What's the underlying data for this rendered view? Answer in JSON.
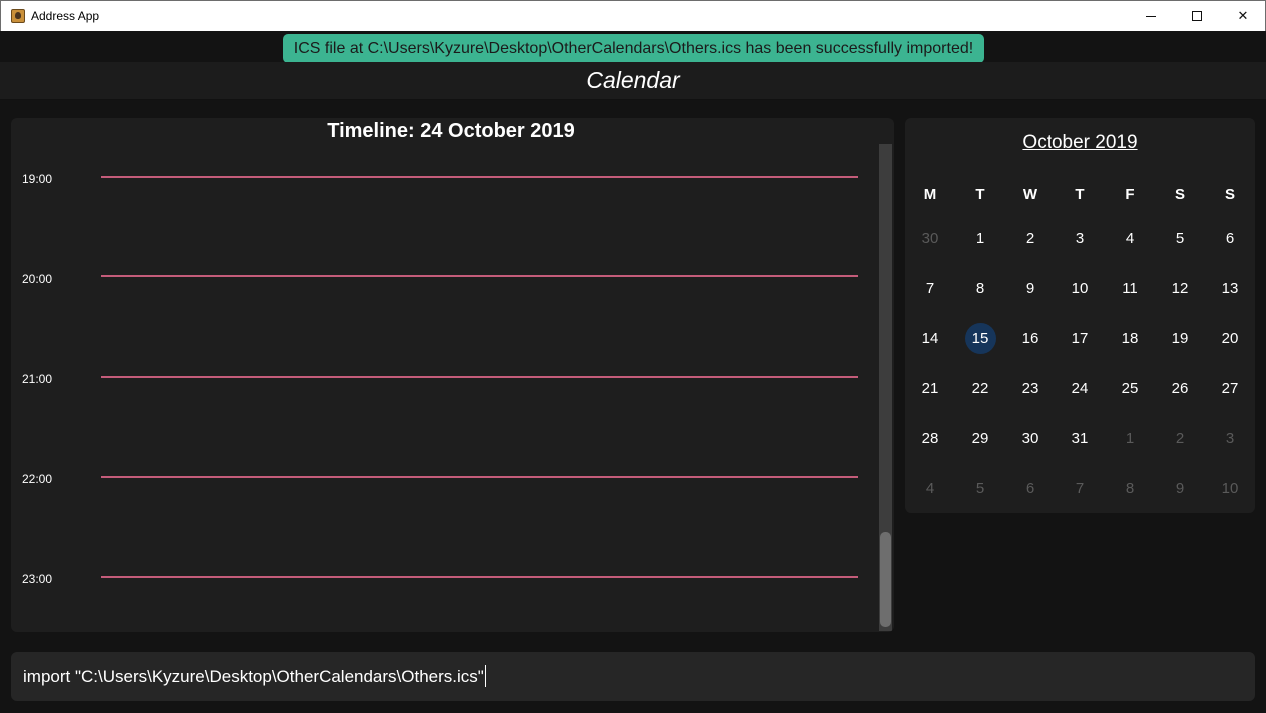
{
  "window": {
    "title": "Address App",
    "min_glyph": "—",
    "close_glyph": "✕"
  },
  "toast": {
    "message": "ICS file at C:\\Users\\Kyzure\\Desktop\\OtherCalendars\\Others.ics has been successfully imported!",
    "color": "#3cb491"
  },
  "header": {
    "title": "Calendar"
  },
  "timeline": {
    "title": "Timeline: 24 October 2019",
    "hours": [
      "19:00",
      "20:00",
      "21:00",
      "22:00",
      "23:00"
    ],
    "line_color": "#c45c7a"
  },
  "calendar": {
    "month_title": "October 2019",
    "weekdays": [
      "M",
      "T",
      "W",
      "T",
      "F",
      "S",
      "S"
    ],
    "weeks": [
      [
        "30",
        "1",
        "2",
        "3",
        "4",
        "5",
        "6"
      ],
      [
        "7",
        "8",
        "9",
        "10",
        "11",
        "12",
        "13"
      ],
      [
        "14",
        "15",
        "16",
        "17",
        "18",
        "19",
        "20"
      ],
      [
        "21",
        "22",
        "23",
        "24",
        "25",
        "26",
        "27"
      ],
      [
        "28",
        "29",
        "30",
        "31",
        "1",
        "2",
        "3"
      ],
      [
        "4",
        "5",
        "6",
        "7",
        "8",
        "9",
        "10"
      ]
    ],
    "today": "15",
    "today_color": "#16355a"
  },
  "command": {
    "value": "import \"C:\\Users\\Kyzure\\Desktop\\OtherCalendars\\Others.ics\""
  }
}
